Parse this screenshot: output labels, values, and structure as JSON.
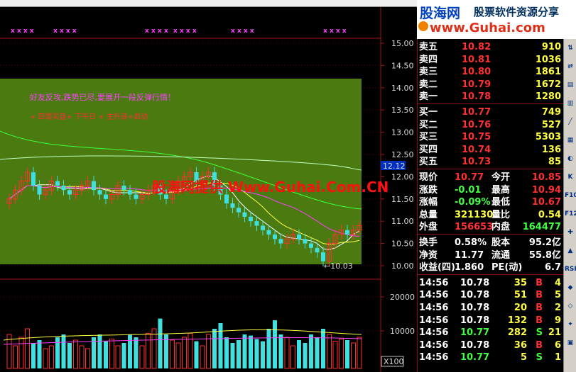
{
  "chart": {
    "price_ticks": [
      "15.00",
      "14.50",
      "14.00",
      "13.50",
      "13.00",
      "12.50",
      "12.00",
      "11.50",
      "11.00",
      "10.50",
      "10.00"
    ],
    "volume_ticks": [
      "20000",
      "10000"
    ],
    "current_price_tag": "12.12",
    "low_label": "←10.03",
    "vol_unit": "X100",
    "annotation_1": "好友反攻,跌势已尽,要展开一段反弹行情！",
    "annotation_2": "+ 四周买盘+ 下午日 + 主升浪+启动",
    "marker_text": "x x x x",
    "watermark": "股海网提供 Www.Guhai.Com.CN",
    "colors": {
      "panel": "#4a7a10",
      "up": "#ff3030",
      "down": "#40e0e0",
      "accent": "#ff00ff"
    }
  },
  "logo": {
    "title": "股海网",
    "subtitle": "股票软件资源分享",
    "url": "www.Guhai.com"
  },
  "quote": {
    "asks": [
      {
        "label": "卖五",
        "price": "10.82",
        "vol": "910"
      },
      {
        "label": "卖四",
        "price": "10.81",
        "vol": "1036"
      },
      {
        "label": "卖三",
        "price": "10.80",
        "vol": "1861"
      },
      {
        "label": "卖二",
        "price": "10.79",
        "vol": "1672"
      },
      {
        "label": "卖一",
        "price": "10.78",
        "vol": "1280"
      }
    ],
    "bids": [
      {
        "label": "买一",
        "price": "10.77",
        "vol": "749"
      },
      {
        "label": "买二",
        "price": "10.76",
        "vol": "527"
      },
      {
        "label": "买三",
        "price": "10.75",
        "vol": "5303"
      },
      {
        "label": "买四",
        "price": "10.74",
        "vol": "136"
      },
      {
        "label": "买五",
        "price": "10.73",
        "vol": "85"
      }
    ],
    "stats": [
      {
        "l1": "现价",
        "v1": "10.77",
        "l2": "今开",
        "v2": "10.85"
      },
      {
        "l1": "涨跌",
        "v1": "-0.01",
        "l2": "最高",
        "v2": "10.94"
      },
      {
        "l1": "涨幅",
        "v1": "-0.09%",
        "l2": "最低",
        "v2": "10.67"
      },
      {
        "l1": "总量",
        "v1": "321130",
        "l2": "量比",
        "v2": "0.54"
      },
      {
        "l1": "外盘",
        "v1": "156653",
        "l2": "内盘",
        "v2": "164477"
      }
    ],
    "fin": [
      {
        "l1": "换手",
        "v1": "0.58%",
        "l2": "股本",
        "v2": "95.2亿"
      },
      {
        "l1": "净资",
        "v1": "11.77",
        "l2": "流通",
        "v2": "55.8亿"
      },
      {
        "l1": "收益(四)",
        "v1": "1.860",
        "l2": "PE(动)",
        "v2": "6.7"
      }
    ],
    "ticks": [
      {
        "time": "14:56",
        "price": "10.78",
        "vol": "35",
        "side": "B",
        "n": "4"
      },
      {
        "time": "14:56",
        "price": "10.78",
        "vol": "51",
        "side": "B",
        "n": "5"
      },
      {
        "time": "14:56",
        "price": "10.78",
        "vol": "20",
        "side": "B",
        "n": "2"
      },
      {
        "time": "14:56",
        "price": "10.78",
        "vol": "132",
        "side": "B",
        "n": "9"
      },
      {
        "time": "14:56",
        "price": "10.77",
        "vol": "282",
        "side": "S",
        "n": "21"
      },
      {
        "time": "14:56",
        "price": "10.78",
        "vol": "36",
        "side": "B",
        "n": "6"
      },
      {
        "time": "14:56",
        "price": "10.77",
        "vol": "5",
        "side": "S",
        "n": "1"
      }
    ]
  },
  "tools": [
    "⇅",
    "⇄",
    "▤",
    "▥",
    "╱",
    "▦",
    "◐",
    "K",
    "F10",
    "F12",
    "✚",
    "▲",
    "RSI",
    "◆",
    "◇",
    "✦",
    "▣"
  ]
}
